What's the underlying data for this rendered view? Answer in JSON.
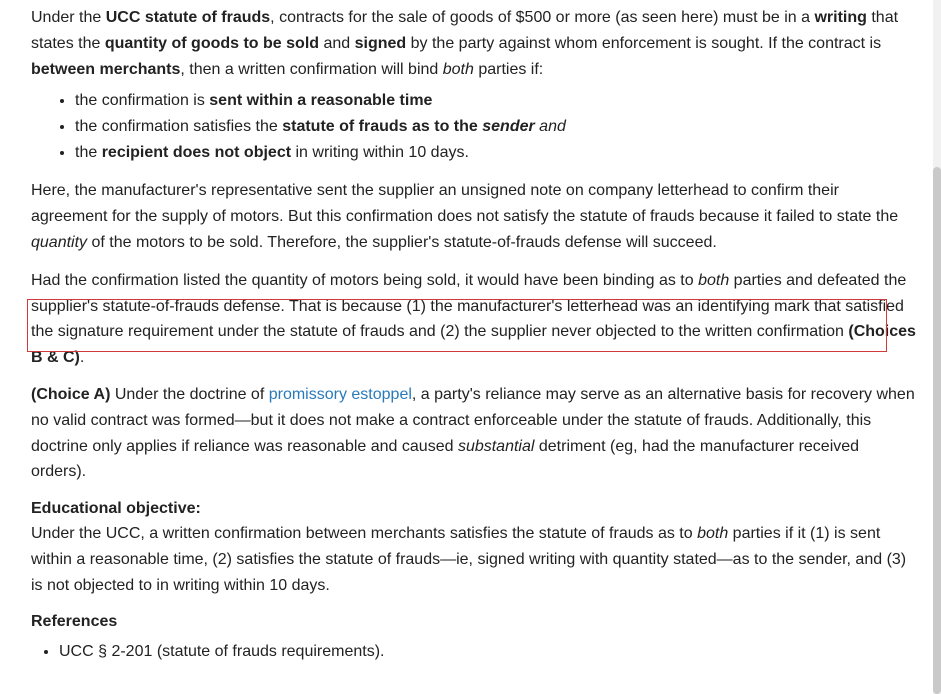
{
  "p1": {
    "t1": "Under the ",
    "b1": "UCC statute of frauds",
    "t2": ", contracts for the sale of goods of $500 or more (as seen here) must be in a ",
    "b2": "writing",
    "t3": " that states the ",
    "b3": "quantity of goods to be sold",
    "t4": " and ",
    "b4": "signed",
    "t5": " by the party against whom enforcement is sought.  If the contract is ",
    "b5": "between merchants",
    "t6": ", then a written confirmation will bind ",
    "i1": "both",
    "t7": " parties if:"
  },
  "list1": [
    {
      "t1": "the confirmation is ",
      "b1": "sent within a reasonable time"
    },
    {
      "t1": "the confirmation satisfies the ",
      "b1": "statute of frauds as to the ",
      "bi1": "sender",
      "i1": " and"
    },
    {
      "t1": "the ",
      "b1": "recipient does not object",
      "t2": " in writing within 10 days."
    }
  ],
  "p2": {
    "t1": "Here, the manufacturer's representative sent the supplier an unsigned note on company letterhead to confirm their agreement for the supply of motors.  But this confirmation does not satisfy the statute of frauds because it failed to state the ",
    "i1": "quantity",
    "t2": " of the motors to be sold.  Therefore, the supplier's statute-of-frauds defense will succeed."
  },
  "p3": {
    "t1": "Had the confirmation listed the quantity of motors being sold, it would have been binding as to ",
    "i1": "both",
    "t2": " parties and defeated the supplier's statute-of-frauds defense.  That is because (1) the manufacturer's letterhead was an identifying mark that satisfied the signature requirement under the statute of frauds and (2) the supplier never objected to the written confirmation ",
    "b1": "(Choices B & C)",
    "t3": "."
  },
  "p4": {
    "b1": "(Choice A)",
    "t1": "  Under the doctrine of ",
    "link": "promissory estoppel",
    "t2": ", a party's reliance may serve as an alternative basis for recovery when no valid contract was formed—but it does not make a contract enforceable under the statute of frauds.  Additionally, this doctrine only applies if reliance was reasonable and caused ",
    "i1": "substantial",
    "t3": " detriment (eg, had the manufacturer received orders)."
  },
  "objective": {
    "heading": "Educational objective:",
    "t1": "Under the UCC, a written confirmation between merchants satisfies the statute of frauds as to ",
    "i1": "both",
    "t2": " parties if it (1) is sent within a reasonable time, (2) satisfies the statute of frauds—ie, signed writing with quantity stated—as to the sender, and (3) is not objected to in writing within 10 days."
  },
  "references": {
    "heading": "References",
    "items": [
      "UCC § 2-201 (statute of frauds requirements)."
    ]
  }
}
